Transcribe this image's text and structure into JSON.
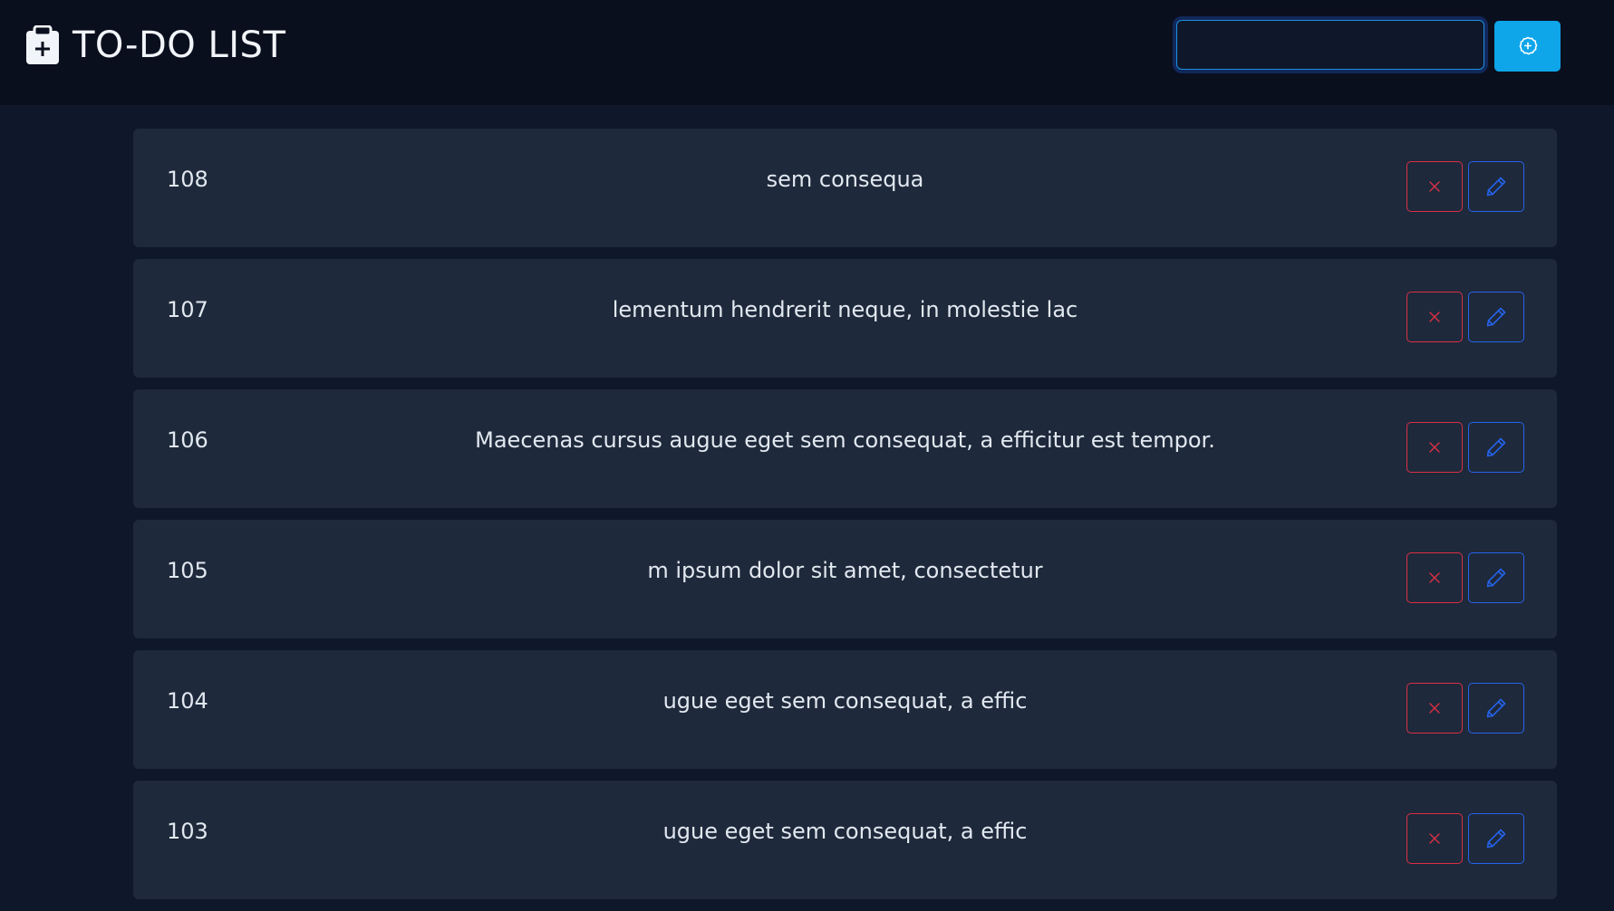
{
  "app": {
    "title": "TO-DO LIST",
    "icon": "clipboard-plus-icon"
  },
  "new_task": {
    "value": "",
    "placeholder": "",
    "add_button_icon": "plus-circle-icon"
  },
  "colors": {
    "header_bg": "#0a0f1e",
    "page_bg": "#0f172a",
    "row_bg": "#1e293b",
    "accent": "#0ea5e9",
    "delete": "#dc2f45",
    "edit": "#2563eb"
  },
  "tasks": [
    {
      "id": "108",
      "text": "sem consequa",
      "delete_icon": "close-icon",
      "edit_icon": "pencil-icon"
    },
    {
      "id": "107",
      "text": "lementum hendrerit neque, in molestie lac",
      "delete_icon": "close-icon",
      "edit_icon": "pencil-icon"
    },
    {
      "id": "106",
      "text": "Maecenas cursus augue eget sem consequat, a efficitur est tempor.",
      "delete_icon": "close-icon",
      "edit_icon": "pencil-icon"
    },
    {
      "id": "105",
      "text": "m ipsum dolor sit amet, consectetur",
      "delete_icon": "close-icon",
      "edit_icon": "pencil-icon"
    },
    {
      "id": "104",
      "text": "ugue eget sem consequat, a effic",
      "delete_icon": "close-icon",
      "edit_icon": "pencil-icon"
    },
    {
      "id": "103",
      "text": "ugue eget sem consequat, a effic",
      "delete_icon": "close-icon",
      "edit_icon": "pencil-icon"
    }
  ]
}
